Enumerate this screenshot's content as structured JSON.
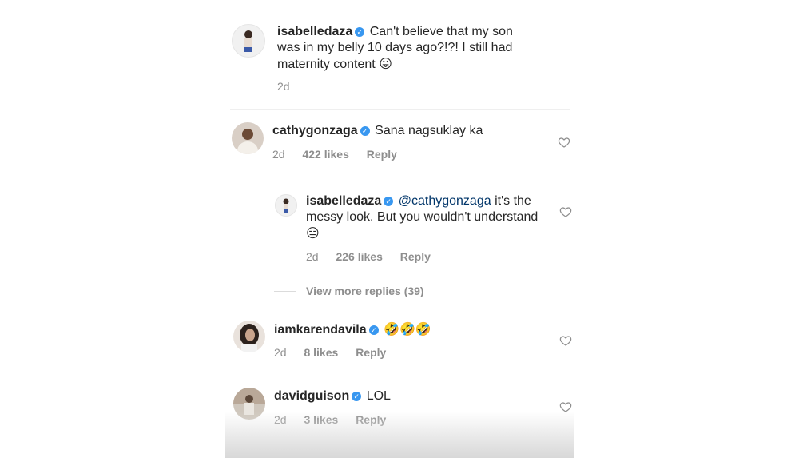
{
  "caption": {
    "username": "isabelledaza",
    "text": "Can't believe that my son was in my belly 10 days ago?!?! I still had maternity content",
    "emoji": "😛",
    "time": "2d"
  },
  "comments": [
    {
      "username": "cathygonzaga",
      "text": "Sana nagsuklay ka",
      "time": "2d",
      "likes": "422 likes",
      "reply": "Reply"
    },
    {
      "username": "isabelledaza",
      "mention": "@cathygonzaga",
      "text": "it's the messy look. But you wouldn't understand",
      "emoji": "😑",
      "time": "2d",
      "likes": "226 likes",
      "reply": "Reply"
    },
    {
      "username": "iamkarendavila",
      "text": "🤣🤣🤣",
      "time": "2d",
      "likes": "8 likes",
      "reply": "Reply"
    },
    {
      "username": "davidguison",
      "text": "LOL",
      "time": "2d",
      "likes": "3 likes",
      "reply": "Reply"
    }
  ],
  "view_more": "View more replies (39)",
  "colors": {
    "verified": "#3897f0",
    "mention": "#003569",
    "meta": "#8e8e8e"
  }
}
